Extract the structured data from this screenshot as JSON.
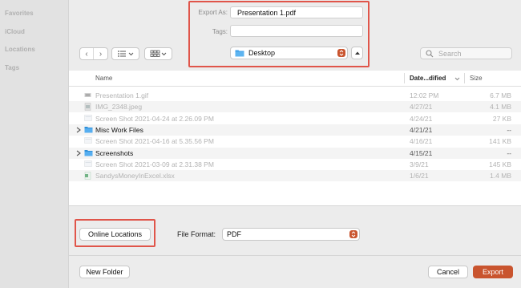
{
  "sidebar": {
    "items": [
      {
        "label": "Favorites"
      },
      {
        "label": "iCloud"
      },
      {
        "label": "Locations"
      },
      {
        "label": "Tags"
      }
    ]
  },
  "export": {
    "export_as_label": "Export As:",
    "export_as_value": "Presentation 1.pdf",
    "tags_label": "Tags:",
    "tags_value": ""
  },
  "toolbar": {
    "back_glyph": "‹",
    "forward_glyph": "›",
    "location": "Desktop",
    "search_placeholder": "Search"
  },
  "columns": {
    "name": "Name",
    "date": "Date...dified",
    "size": "Size"
  },
  "files": [
    {
      "name": "Presentation 1.gif",
      "date": "12:02 PM",
      "size": "6.7 MB",
      "type": "file",
      "icon": "gif-file-icon"
    },
    {
      "name": "IMG_2348.jpeg",
      "date": "4/27/21",
      "size": "4.1 MB",
      "type": "file",
      "icon": "image-file-icon"
    },
    {
      "name": "Screen Shot 2021-04-24 at 2.26.09 PM",
      "date": "4/24/21",
      "size": "27 KB",
      "type": "file",
      "icon": "screenshot-file-icon"
    },
    {
      "name": "Misc Work Files",
      "date": "4/21/21",
      "size": "--",
      "type": "folder",
      "icon": "folder-icon"
    },
    {
      "name": "Screen Shot 2021-04-16 at 5.35.56 PM",
      "date": "4/16/21",
      "size": "141 KB",
      "type": "file",
      "icon": "screenshot-file-icon"
    },
    {
      "name": "Screenshots",
      "date": "4/15/21",
      "size": "--",
      "type": "folder",
      "icon": "folder-icon"
    },
    {
      "name": "Screen Shot 2021-03-09 at 2.31.38 PM",
      "date": "3/9/21",
      "size": "145 KB",
      "type": "file",
      "icon": "screenshot-file-icon"
    },
    {
      "name": "SandysMoneyInExcel.xlsx",
      "date": "1/6/21",
      "size": "1.4 MB",
      "type": "file",
      "icon": "excel-file-icon"
    }
  ],
  "options": {
    "online_locations": "Online Locations",
    "file_format_label": "File Format:",
    "file_format_value": "PDF"
  },
  "footer": {
    "new_folder": "New Folder",
    "cancel": "Cancel",
    "export": "Export"
  },
  "colors": {
    "accent": "#c9542e",
    "highlight": "#e0554a",
    "folder": "#3b9ee8"
  }
}
